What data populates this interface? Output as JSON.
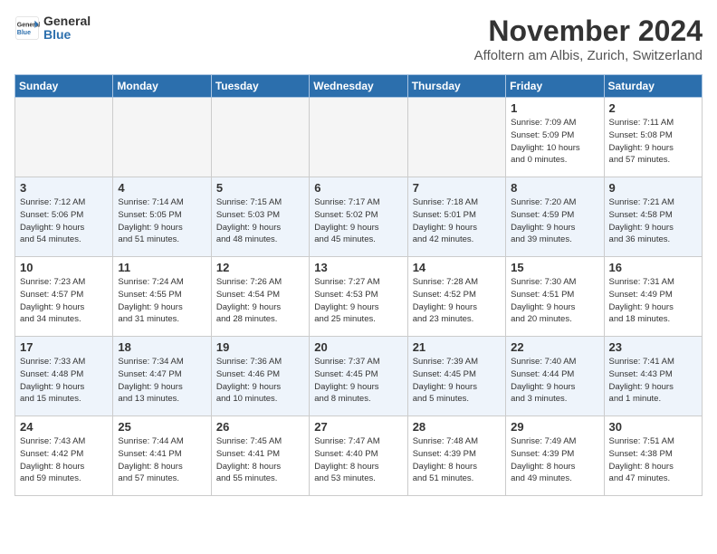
{
  "header": {
    "logo_line1": "General",
    "logo_line2": "Blue",
    "month": "November 2024",
    "location": "Affoltern am Albis, Zurich, Switzerland"
  },
  "days_of_week": [
    "Sunday",
    "Monday",
    "Tuesday",
    "Wednesday",
    "Thursday",
    "Friday",
    "Saturday"
  ],
  "weeks": [
    [
      {
        "day": "",
        "info": ""
      },
      {
        "day": "",
        "info": ""
      },
      {
        "day": "",
        "info": ""
      },
      {
        "day": "",
        "info": ""
      },
      {
        "day": "",
        "info": ""
      },
      {
        "day": "1",
        "info": "Sunrise: 7:09 AM\nSunset: 5:09 PM\nDaylight: 10 hours\nand 0 minutes."
      },
      {
        "day": "2",
        "info": "Sunrise: 7:11 AM\nSunset: 5:08 PM\nDaylight: 9 hours\nand 57 minutes."
      }
    ],
    [
      {
        "day": "3",
        "info": "Sunrise: 7:12 AM\nSunset: 5:06 PM\nDaylight: 9 hours\nand 54 minutes."
      },
      {
        "day": "4",
        "info": "Sunrise: 7:14 AM\nSunset: 5:05 PM\nDaylight: 9 hours\nand 51 minutes."
      },
      {
        "day": "5",
        "info": "Sunrise: 7:15 AM\nSunset: 5:03 PM\nDaylight: 9 hours\nand 48 minutes."
      },
      {
        "day": "6",
        "info": "Sunrise: 7:17 AM\nSunset: 5:02 PM\nDaylight: 9 hours\nand 45 minutes."
      },
      {
        "day": "7",
        "info": "Sunrise: 7:18 AM\nSunset: 5:01 PM\nDaylight: 9 hours\nand 42 minutes."
      },
      {
        "day": "8",
        "info": "Sunrise: 7:20 AM\nSunset: 4:59 PM\nDaylight: 9 hours\nand 39 minutes."
      },
      {
        "day": "9",
        "info": "Sunrise: 7:21 AM\nSunset: 4:58 PM\nDaylight: 9 hours\nand 36 minutes."
      }
    ],
    [
      {
        "day": "10",
        "info": "Sunrise: 7:23 AM\nSunset: 4:57 PM\nDaylight: 9 hours\nand 34 minutes."
      },
      {
        "day": "11",
        "info": "Sunrise: 7:24 AM\nSunset: 4:55 PM\nDaylight: 9 hours\nand 31 minutes."
      },
      {
        "day": "12",
        "info": "Sunrise: 7:26 AM\nSunset: 4:54 PM\nDaylight: 9 hours\nand 28 minutes."
      },
      {
        "day": "13",
        "info": "Sunrise: 7:27 AM\nSunset: 4:53 PM\nDaylight: 9 hours\nand 25 minutes."
      },
      {
        "day": "14",
        "info": "Sunrise: 7:28 AM\nSunset: 4:52 PM\nDaylight: 9 hours\nand 23 minutes."
      },
      {
        "day": "15",
        "info": "Sunrise: 7:30 AM\nSunset: 4:51 PM\nDaylight: 9 hours\nand 20 minutes."
      },
      {
        "day": "16",
        "info": "Sunrise: 7:31 AM\nSunset: 4:49 PM\nDaylight: 9 hours\nand 18 minutes."
      }
    ],
    [
      {
        "day": "17",
        "info": "Sunrise: 7:33 AM\nSunset: 4:48 PM\nDaylight: 9 hours\nand 15 minutes."
      },
      {
        "day": "18",
        "info": "Sunrise: 7:34 AM\nSunset: 4:47 PM\nDaylight: 9 hours\nand 13 minutes."
      },
      {
        "day": "19",
        "info": "Sunrise: 7:36 AM\nSunset: 4:46 PM\nDaylight: 9 hours\nand 10 minutes."
      },
      {
        "day": "20",
        "info": "Sunrise: 7:37 AM\nSunset: 4:45 PM\nDaylight: 9 hours\nand 8 minutes."
      },
      {
        "day": "21",
        "info": "Sunrise: 7:39 AM\nSunset: 4:45 PM\nDaylight: 9 hours\nand 5 minutes."
      },
      {
        "day": "22",
        "info": "Sunrise: 7:40 AM\nSunset: 4:44 PM\nDaylight: 9 hours\nand 3 minutes."
      },
      {
        "day": "23",
        "info": "Sunrise: 7:41 AM\nSunset: 4:43 PM\nDaylight: 9 hours\nand 1 minute."
      }
    ],
    [
      {
        "day": "24",
        "info": "Sunrise: 7:43 AM\nSunset: 4:42 PM\nDaylight: 8 hours\nand 59 minutes."
      },
      {
        "day": "25",
        "info": "Sunrise: 7:44 AM\nSunset: 4:41 PM\nDaylight: 8 hours\nand 57 minutes."
      },
      {
        "day": "26",
        "info": "Sunrise: 7:45 AM\nSunset: 4:41 PM\nDaylight: 8 hours\nand 55 minutes."
      },
      {
        "day": "27",
        "info": "Sunrise: 7:47 AM\nSunset: 4:40 PM\nDaylight: 8 hours\nand 53 minutes."
      },
      {
        "day": "28",
        "info": "Sunrise: 7:48 AM\nSunset: 4:39 PM\nDaylight: 8 hours\nand 51 minutes."
      },
      {
        "day": "29",
        "info": "Sunrise: 7:49 AM\nSunset: 4:39 PM\nDaylight: 8 hours\nand 49 minutes."
      },
      {
        "day": "30",
        "info": "Sunrise: 7:51 AM\nSunset: 4:38 PM\nDaylight: 8 hours\nand 47 minutes."
      }
    ]
  ]
}
